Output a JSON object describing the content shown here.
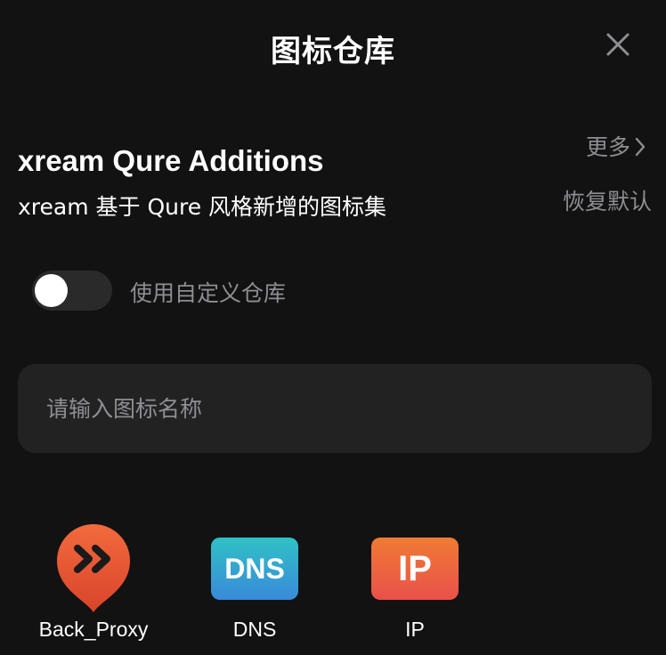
{
  "header": {
    "title": "图标仓库",
    "close_icon": "close-icon"
  },
  "repository": {
    "name": "xream Qure Additions",
    "description": "xream 基于 Qure 风格新增的图标集",
    "more_label": "更多",
    "more_icon": "chevron-right-icon",
    "restore_label": "恢复默认"
  },
  "custom_repo_toggle": {
    "label": "使用自定义仓库",
    "on": false
  },
  "search": {
    "placeholder": "请输入图标名称",
    "value": ""
  },
  "icons": [
    {
      "name": "Back_Proxy",
      "glyph": "»",
      "colors": [
        "#f26a3d",
        "#d9442b"
      ]
    },
    {
      "name": "DNS",
      "glyph": "DNS",
      "colors": [
        "#2fc1c6",
        "#3a8ad8"
      ]
    },
    {
      "name": "IP",
      "glyph": "IP",
      "colors": [
        "#f07b33",
        "#e9504b"
      ]
    }
  ]
}
